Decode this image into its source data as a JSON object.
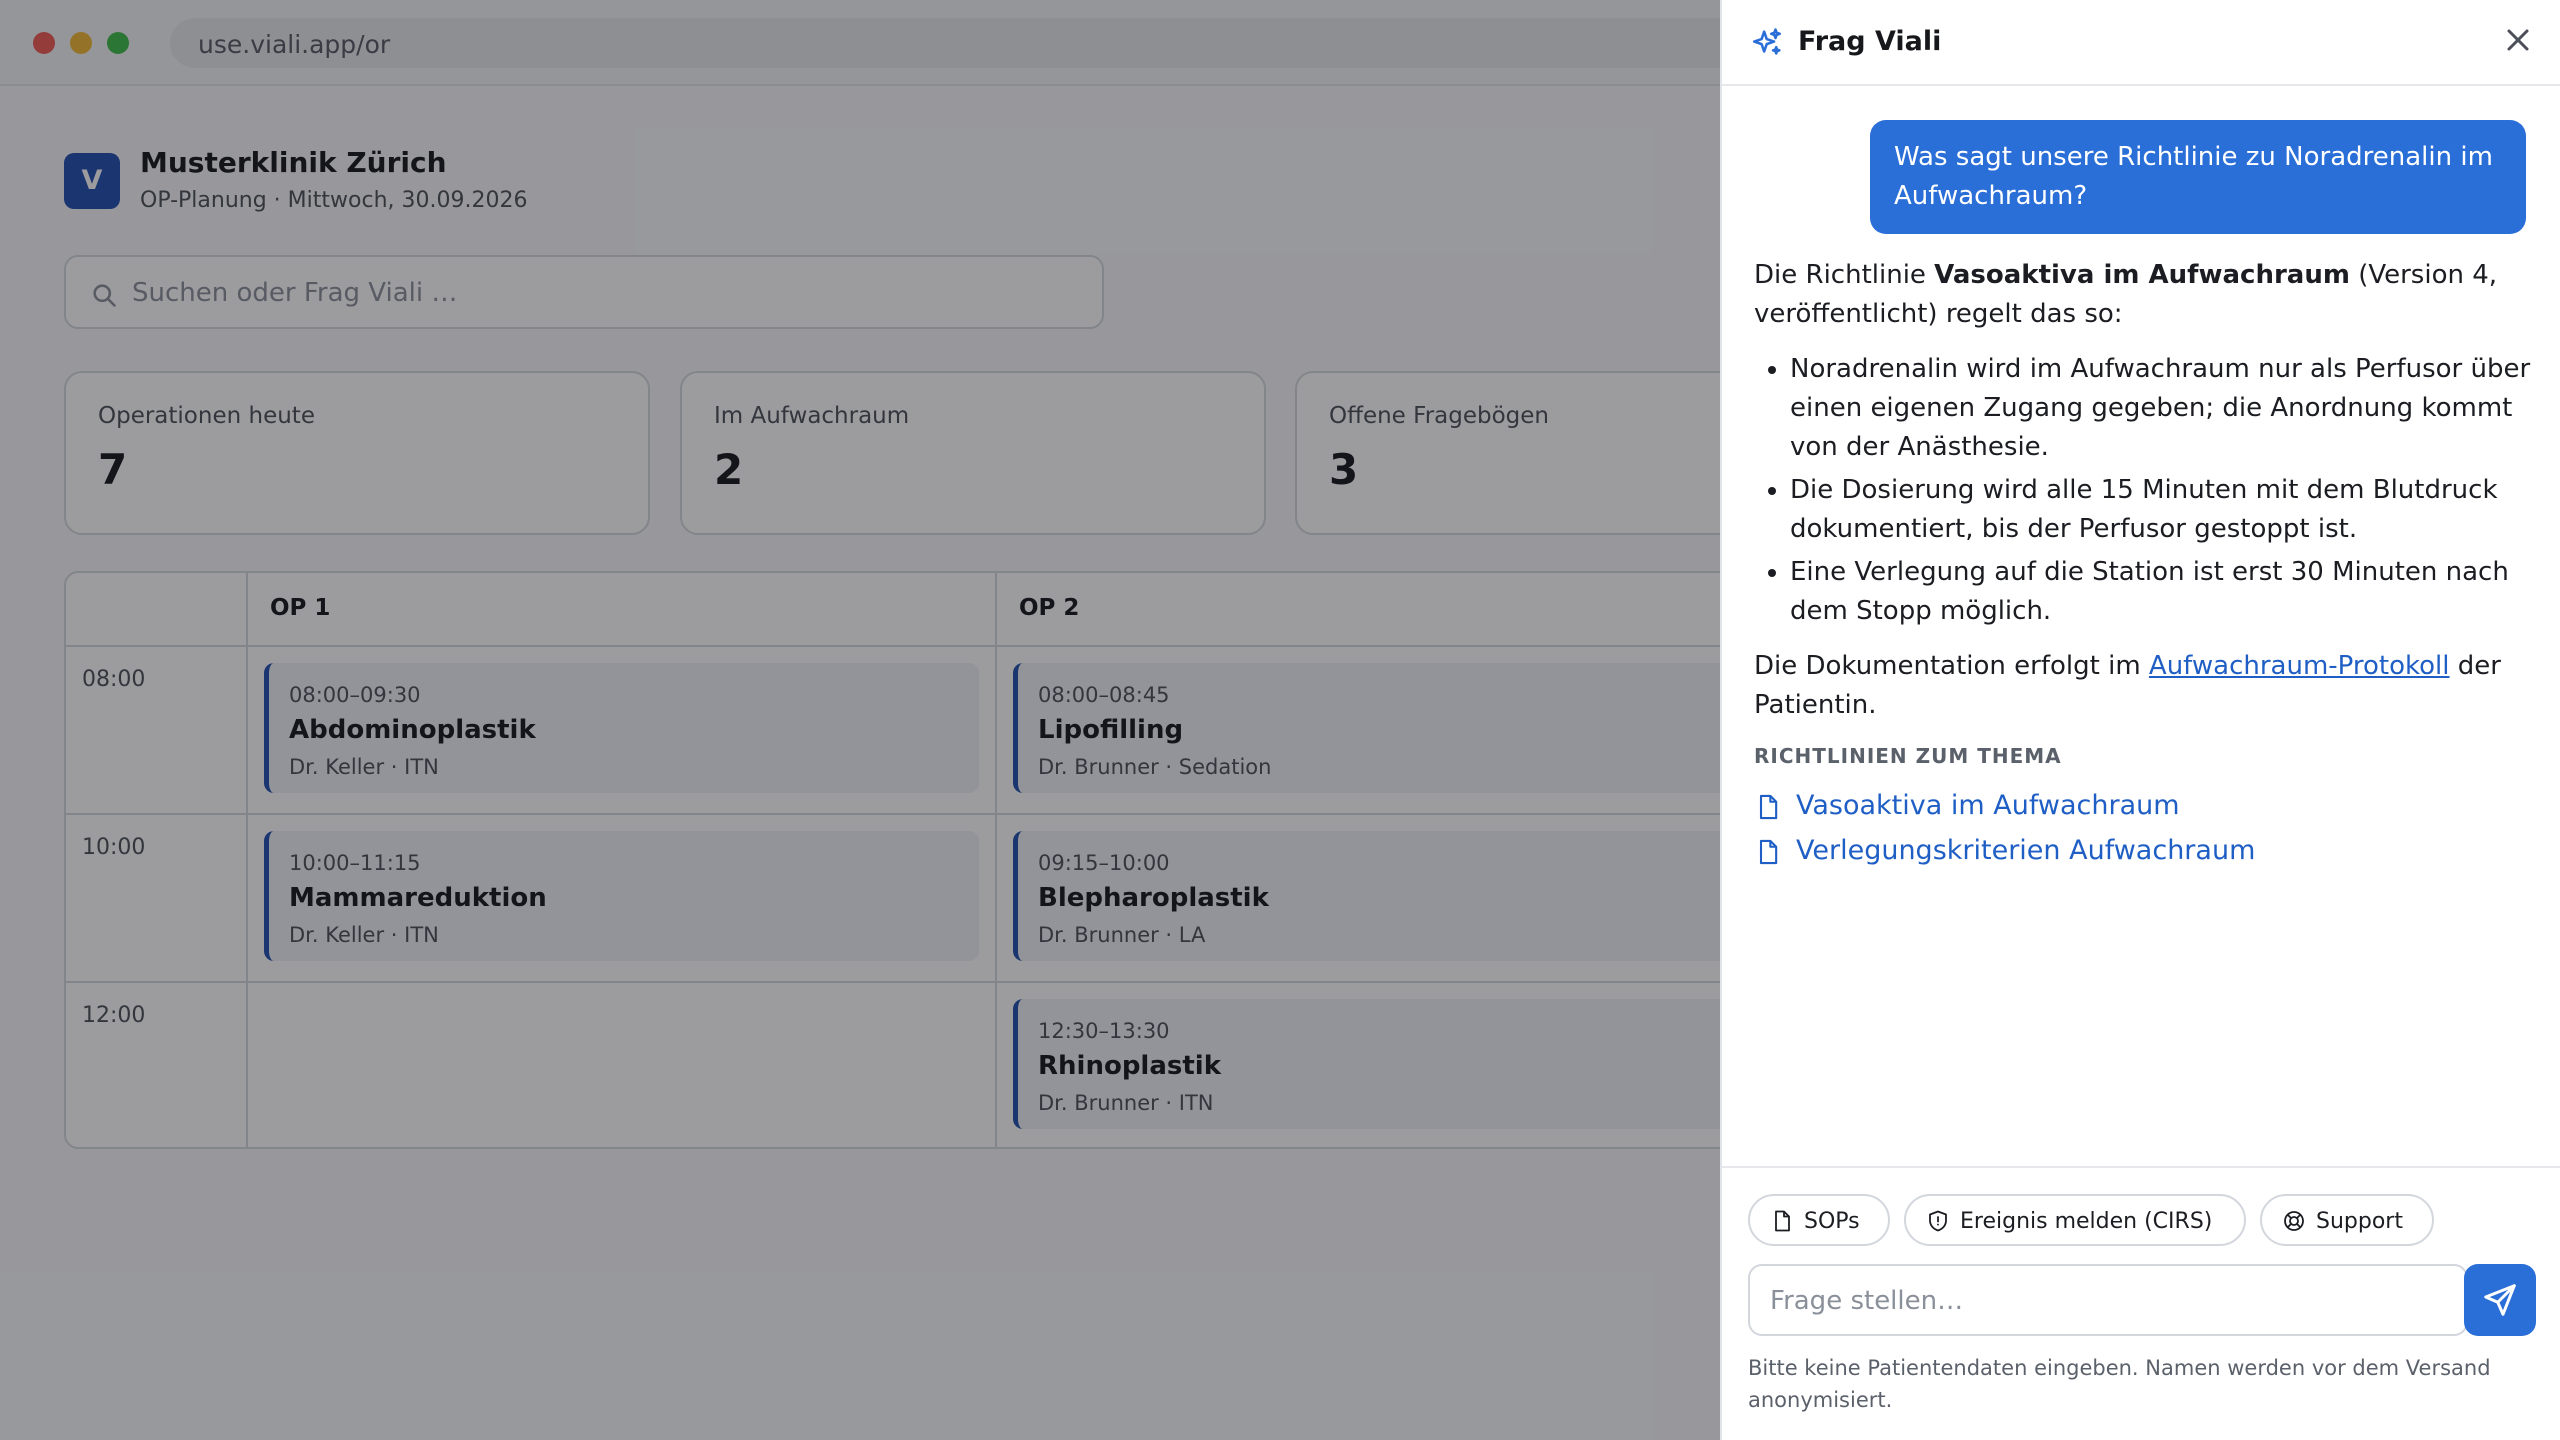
{
  "browser": {
    "url": "use.viali.app/or"
  },
  "clinic": {
    "logo_letter": "V",
    "name": "Musterklinik Zürich",
    "subtitle": "OP-Planung · Mittwoch, 30.09.2026"
  },
  "search": {
    "placeholder": "Suchen oder Frag Viali …"
  },
  "stats": [
    {
      "label": "Operationen heute",
      "value": "7"
    },
    {
      "label": "Im Aufwachraum",
      "value": "2"
    },
    {
      "label": "Offene Fragebögen",
      "value": "3"
    }
  ],
  "schedule": {
    "rooms": [
      "OP 1",
      "OP 2"
    ],
    "times": [
      "08:00",
      "10:00",
      "12:00"
    ],
    "op1": [
      {
        "time": "08:00–09:30",
        "title": "Abdominoplastik",
        "meta": "Dr. Keller · ITN"
      },
      {
        "time": "10:00–11:15",
        "title": "Mammareduktion",
        "meta": "Dr. Keller · ITN"
      }
    ],
    "op2": [
      {
        "time": "08:00–08:45",
        "title": "Lipofilling",
        "meta": "Dr. Brunner · Sedation"
      },
      {
        "time": "09:15–10:00",
        "title": "Blepharoplastik",
        "meta": "Dr. Brunner · LA"
      },
      {
        "time": "12:30–13:30",
        "title": "Rhinoplastik",
        "meta": "Dr. Brunner · ITN"
      }
    ]
  },
  "panel": {
    "title": "Frag Viali",
    "question": "Was sagt unsere Richtlinie zu Noradrenalin im Aufwachraum?",
    "answer": {
      "intro_pre": "Die Richtlinie ",
      "intro_bold": "Vasoaktiva im Aufwachraum",
      "intro_post": " (Version 4, veröffentlicht) regelt das so:",
      "bullets": [
        "Noradrenalin wird im Aufwachraum nur als Perfusor über einen eigenen Zugang gegeben; die Anordnung kommt von der Anästhesie.",
        "Die Dosierung wird alle 15 Minuten mit dem Blutdruck dokumentiert, bis der Perfusor gestoppt ist.",
        "Eine Verlegung auf die Station ist erst 30 Minuten nach dem Stopp möglich."
      ],
      "outro_pre": "Die Dokumentation erfolgt im ",
      "outro_link": "Aufwachraum-Protokoll",
      "outro_post": " der Patientin."
    },
    "guides_heading": "RICHTLINIEN ZUM THEMA",
    "guides": [
      "Vasoaktiva im Aufwachraum",
      "Verlegungskriterien Aufwachraum"
    ],
    "chips": [
      "SOPs",
      "Ereignis melden (CIRS)",
      "Support"
    ],
    "input_placeholder": "Frage stellen…",
    "disclaimer": "Bitte keine Patientendaten eingeben. Namen werden vor dem Versand anonymisiert."
  },
  "colors": {
    "accent": "#2a6ed8",
    "brand": "#1f4fae",
    "link": "#1f5fc5"
  }
}
